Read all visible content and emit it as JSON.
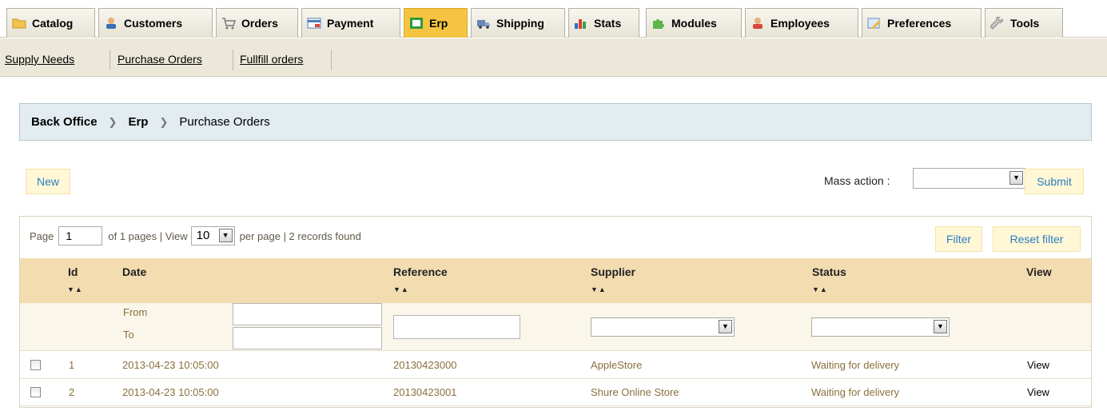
{
  "tabs": [
    {
      "label": "Catalog",
      "icon": "folder-icon"
    },
    {
      "label": "Customers",
      "icon": "customers-icon"
    },
    {
      "label": "Orders",
      "icon": "cart-icon"
    },
    {
      "label": "Payment",
      "icon": "payment-icon"
    },
    {
      "label": "Erp",
      "icon": "erp-icon",
      "active": true
    },
    {
      "label": "Shipping",
      "icon": "truck-icon"
    },
    {
      "label": "Stats",
      "icon": "bar-chart-icon"
    },
    {
      "label": "Modules",
      "icon": "puzzle-icon"
    },
    {
      "label": "Employees",
      "icon": "employees-icon"
    },
    {
      "label": "Preferences",
      "icon": "preferences-icon"
    },
    {
      "label": "Tools",
      "icon": "wrench-icon"
    }
  ],
  "subnav": [
    "Supply Needs",
    "Purchase Orders",
    "Fullfill orders"
  ],
  "breadcrumb": {
    "root": "Back Office",
    "section": "Erp",
    "page": "Purchase Orders"
  },
  "actions": {
    "new_label": "New",
    "mass_action_label": "Mass action :",
    "mass_action_value": "",
    "submit_label": "Submit"
  },
  "pager": {
    "page_label": "Page",
    "page_value": "1",
    "of_pages_text": "of 1 pages | View",
    "per_page_value": "10",
    "per_page_text": "per page | 2 records found",
    "filter_label": "Filter",
    "reset_label": "Reset filter"
  },
  "table": {
    "columns": [
      "Id",
      "Date",
      "Reference",
      "Supplier",
      "Status",
      "View"
    ],
    "filters": {
      "from_label": "From",
      "to_label": "To"
    },
    "rows": [
      {
        "id": "1",
        "date": "2013-04-23 10:05:00",
        "reference": "20130423000",
        "supplier": "AppleStore",
        "status": "Waiting for delivery",
        "view": "View"
      },
      {
        "id": "2",
        "date": "2013-04-23 10:05:00",
        "reference": "20130423001",
        "supplier": "Shure Online Store",
        "status": "Waiting for delivery",
        "view": "View"
      }
    ]
  },
  "colors": {
    "active_tab": "#f5c542",
    "link_blue": "#2a7fc0",
    "row_text": "#8b6f3e",
    "header_bg": "#f2dcb0"
  }
}
